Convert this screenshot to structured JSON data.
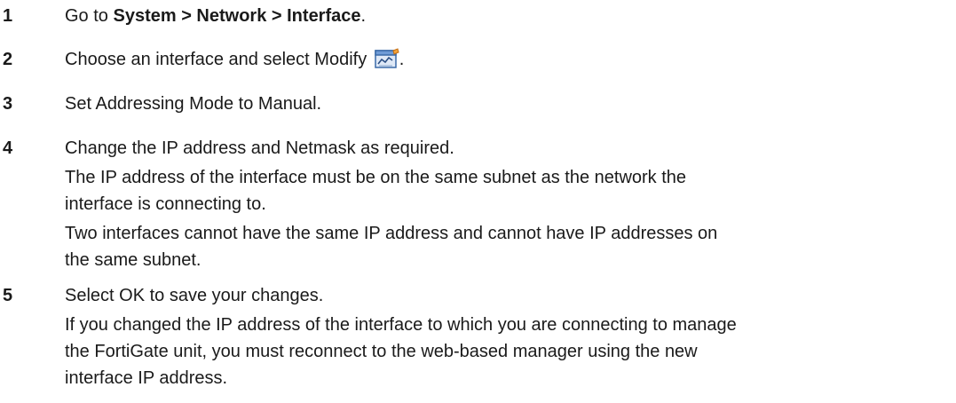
{
  "steps": [
    {
      "number": "1",
      "lines": [
        {
          "pre": "Go to ",
          "bold": "System > Network > Interface",
          "post": "."
        }
      ]
    },
    {
      "number": "2",
      "text_before_icon": "Choose an interface and select Modify ",
      "icon": "modify-icon",
      "text_after_icon": "."
    },
    {
      "number": "3",
      "text": "Set Addressing Mode to Manual."
    },
    {
      "number": "4",
      "paragraphs": [
        [
          "Change the IP address and Netmask as required."
        ],
        [
          "The IP address of the interface must be on the same subnet as the network the",
          "interface is connecting to."
        ],
        [
          "Two interfaces cannot have the same IP address and cannot have IP addresses on",
          "the same subnet."
        ]
      ]
    },
    {
      "number": "5",
      "paragraphs": [
        [
          "Select OK to save your changes."
        ],
        [
          "If you changed the IP address of the interface to which you are connecting to manage",
          "the FortiGate unit, you must reconnect to the web-based manager using the new",
          "interface IP address."
        ]
      ]
    }
  ]
}
